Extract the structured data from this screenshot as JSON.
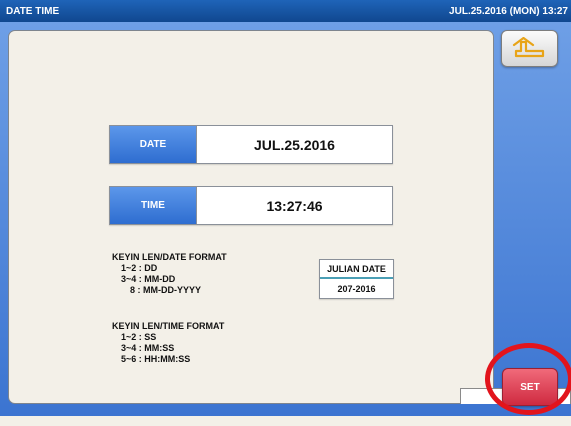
{
  "titlebar": {
    "title": "DATE TIME",
    "datetime": "JUL.25.2016 (MON) 13:27"
  },
  "date_field": {
    "label": "DATE",
    "value": "JUL.25.2016"
  },
  "time_field": {
    "label": "TIME",
    "value": "13:27:46"
  },
  "date_format": {
    "heading": "KEYIN LEN/DATE FORMAT",
    "lines": [
      "1~2 : DD",
      "3~4 : MM-DD",
      "8 : MM-DD-YYYY"
    ]
  },
  "time_format": {
    "heading": "KEYIN LEN/TIME FORMAT",
    "lines": [
      "1~2 : SS",
      "3~4 : MM:SS",
      "5~6 : HH:MM:SS"
    ]
  },
  "julian": {
    "header": "JULIAN DATE",
    "value": "207-2016"
  },
  "buttons": {
    "back_icon": "return-arrow-icon",
    "set_label": "SET"
  },
  "colors": {
    "titlebar": "#10478f",
    "label_blue": "#2e6dd0",
    "set_red": "#cf2a40",
    "highlight": "#e2141c",
    "back_arrow": "#e8a418"
  }
}
